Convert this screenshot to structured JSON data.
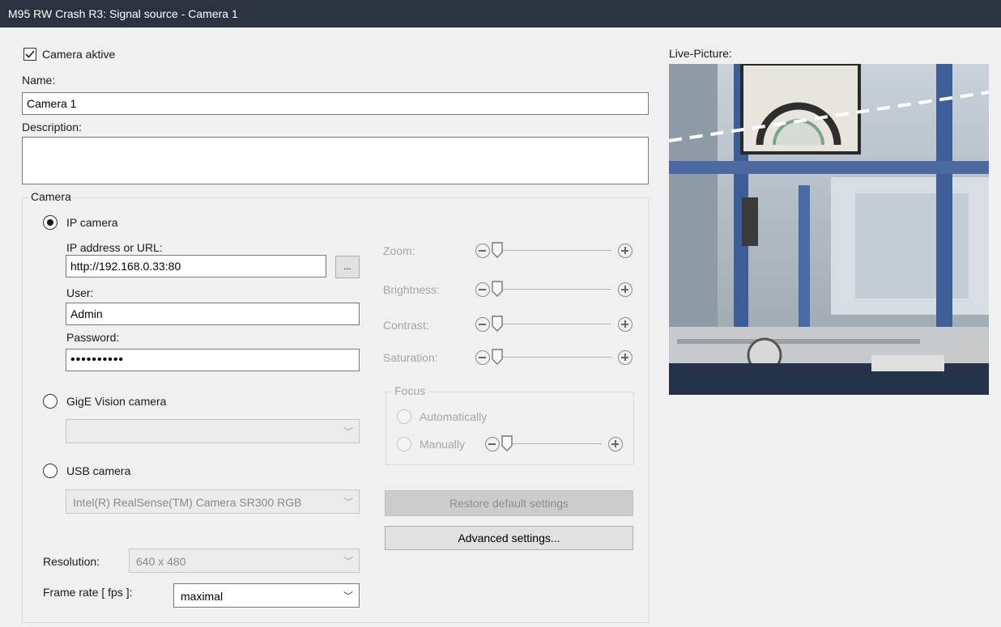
{
  "window": {
    "title": "M95 RW Crash R3: Signal source - Camera 1"
  },
  "camera_active": {
    "label": "Camera aktive",
    "checked": true
  },
  "name": {
    "label": "Name:",
    "value": "Camera 1"
  },
  "description": {
    "label": "Description:",
    "value": ""
  },
  "camera_group": {
    "title": "Camera",
    "ip": {
      "label": "IP camera",
      "selected": true,
      "address_label": "IP address or URL:",
      "address_value": "http://192.168.0.33:80",
      "browse_label": "...",
      "user_label": "User:",
      "user_value": "Admin",
      "password_label": "Password:",
      "password_value": "••••••••••"
    },
    "gige": {
      "label": "GigE Vision camera",
      "selected": false,
      "value": ""
    },
    "usb": {
      "label": "USB camera",
      "selected": false,
      "value": "Intel(R) RealSense(TM) Camera SR300 RGB"
    },
    "sliders": {
      "zoom": {
        "label": "Zoom:",
        "level": 0
      },
      "brightness": {
        "label": "Brightness:",
        "level": 0
      },
      "contrast": {
        "label": "Contrast:",
        "level": 0
      },
      "saturation": {
        "label": "Saturation:",
        "level": 0
      }
    },
    "focus": {
      "title": "Focus",
      "auto_label": "Automatically",
      "manual_label": "Manually",
      "level": 0
    },
    "restore_label": "Restore default settings",
    "advanced_label": "Advanced settings...",
    "resolution": {
      "label": "Resolution:",
      "value": "640 x 480"
    },
    "framerate": {
      "label": "Frame rate [ fps ]:",
      "value": "maximal"
    }
  },
  "live": {
    "label": "Live-Picture:"
  },
  "colors": {
    "titlebar": "#2b3240",
    "background": "#f0f0f0",
    "disabled_text": "#a6a6a6"
  }
}
